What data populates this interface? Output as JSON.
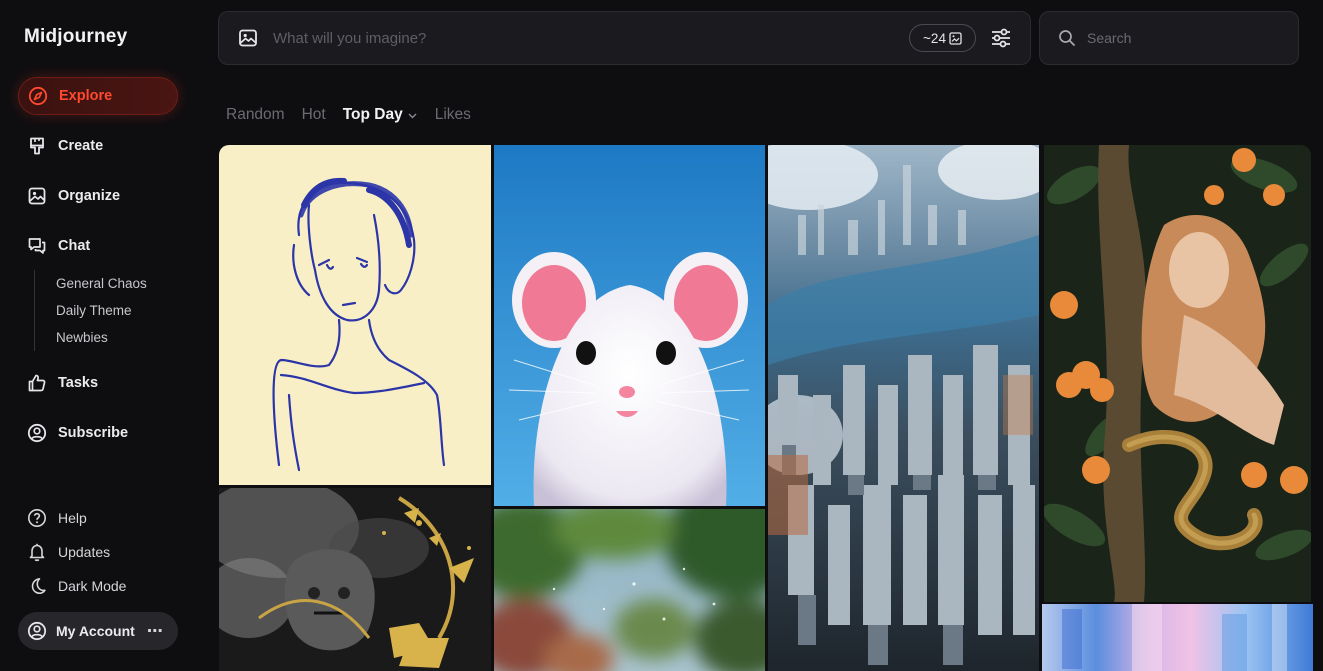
{
  "app": {
    "name": "Midjourney"
  },
  "sidebar": {
    "nav": [
      {
        "label": "Explore",
        "icon": "compass-icon",
        "active": true
      },
      {
        "label": "Create",
        "icon": "brush-icon"
      },
      {
        "label": "Organize",
        "icon": "image-icon"
      },
      {
        "label": "Chat",
        "icon": "chat-icon"
      }
    ],
    "chat_channels": [
      "General Chaos",
      "Daily Theme",
      "Newbies"
    ],
    "more": [
      {
        "label": "Tasks",
        "icon": "thumbs-up-icon"
      },
      {
        "label": "Subscribe",
        "icon": "user-circle-icon"
      }
    ],
    "footer": [
      {
        "label": "Help",
        "icon": "help-circle-icon"
      },
      {
        "label": "Updates",
        "icon": "bell-icon"
      },
      {
        "label": "Dark Mode",
        "icon": "moon-icon"
      }
    ],
    "account": {
      "label": "My Account",
      "icon": "user-circle-icon",
      "more": "⋯"
    }
  },
  "prompt": {
    "placeholder": "What will you imagine?",
    "credits": "~24"
  },
  "search": {
    "placeholder": "Search"
  },
  "tabs": [
    {
      "label": "Random"
    },
    {
      "label": "Hot"
    },
    {
      "label": "Top Day",
      "active": true
    },
    {
      "label": "Likes"
    }
  ],
  "colors": {
    "accent": "#ff4a2e",
    "background": "#0e0e11",
    "panel": "#1b1b1f"
  }
}
